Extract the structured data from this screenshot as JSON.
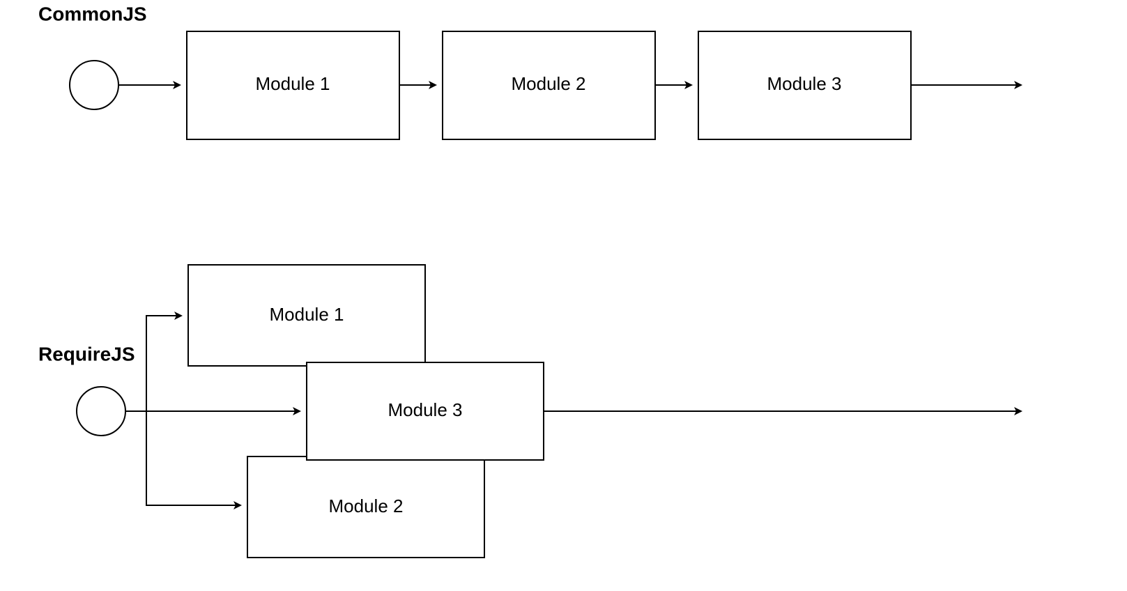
{
  "commonjs": {
    "title": "CommonJS",
    "modules": [
      "Module 1",
      "Module 2",
      "Module 3"
    ]
  },
  "requirejs": {
    "title": "RequireJS",
    "modules": [
      "Module 1",
      "Module 2",
      "Module 3"
    ]
  }
}
